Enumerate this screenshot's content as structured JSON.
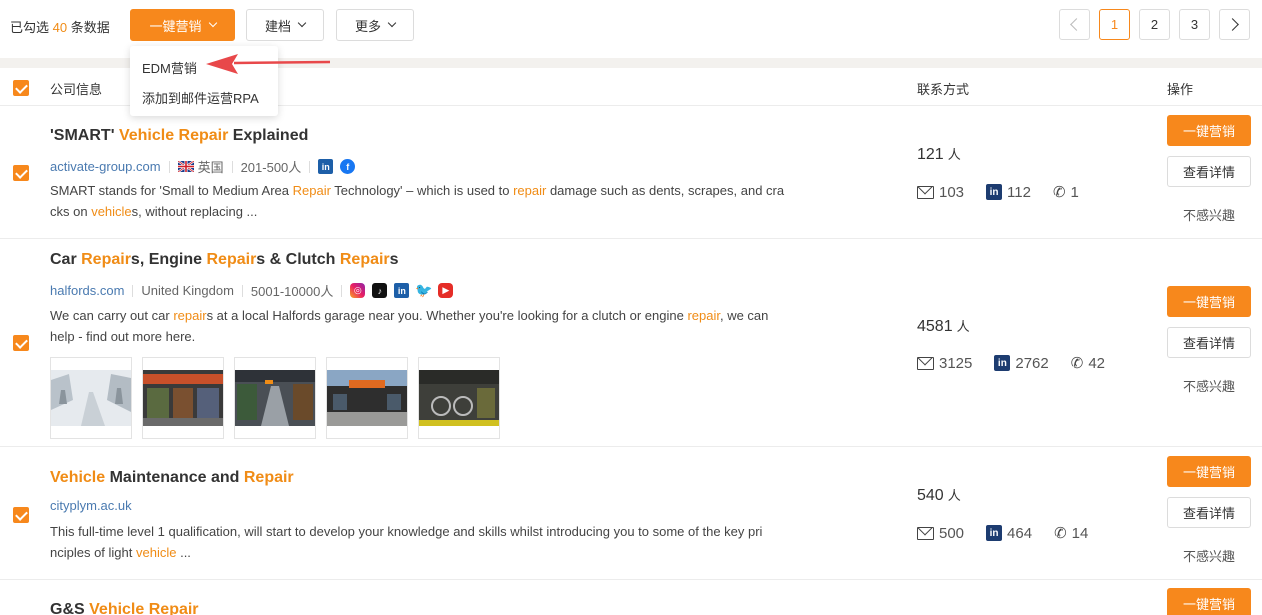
{
  "toolbar": {
    "selected_prefix": "已勾选",
    "selected_count": "40",
    "selected_suffix": "条数据",
    "btn_marketing": "一键营销",
    "btn_archive": "建档",
    "btn_more": "更多"
  },
  "pagination": {
    "pages": [
      "1",
      "2",
      "3"
    ],
    "current": "1"
  },
  "dropdown": {
    "items": [
      "EDM营销",
      "添加到邮件运营RPA"
    ]
  },
  "header": {
    "company": "公司信息",
    "contact": "联系方式",
    "action": "操作"
  },
  "rows": [
    {
      "title_parts": [
        "'SMART' ",
        "Vehicle",
        " ",
        "Repair",
        " Explained"
      ],
      "domain": "activate-group.com",
      "country": "英国",
      "size": "201-500人",
      "desc_parts": [
        "SMART stands for 'Small to Medium Area ",
        "Repair",
        " Technology' – which is used to ",
        "repair",
        " damage such as dents, scrapes, and cra",
        "cks on ",
        "vehicle",
        "s, without replacing ..."
      ],
      "contacts": "121",
      "unit": "人",
      "emails": "103",
      "linkedin": "112",
      "phones": "1"
    },
    {
      "title_parts": [
        "Car ",
        "Repair",
        "s, Engine ",
        "Repair",
        "s & Clutch ",
        "Repair",
        "s"
      ],
      "domain": "halfords.com",
      "country": "United Kingdom",
      "size": "5001-10000人",
      "desc_parts": [
        "We can carry out car ",
        "repair",
        "s at a local Halfords garage near you. Whether you're looking for a clutch or engine ",
        "repair",
        ", we can",
        "help - find out more here."
      ],
      "contacts": "4581",
      "unit": "人",
      "emails": "3125",
      "linkedin": "2762",
      "phones": "42"
    },
    {
      "title_parts": [
        "Vehicle",
        " Maintenance and ",
        "Repair"
      ],
      "domain": "cityplym.ac.uk",
      "desc_parts": [
        "This full-time level 1 qualification, will start to develop your knowledge and skills whilst introducing you to some of the key pri",
        "nciples of light ",
        "vehicle",
        " ..."
      ],
      "contacts": "540",
      "unit": "人",
      "emails": "500",
      "linkedin": "464",
      "phones": "14"
    },
    {
      "title_parts": [
        "G&S ",
        "Vehicle",
        " ",
        "Repair"
      ]
    }
  ],
  "actions": {
    "primary": "一键营销",
    "detail": "查看详情",
    "not_interested": "不感兴趣"
  },
  "icons": [
    "chevron-down-icon",
    "chevron-left-icon",
    "chevron-right-icon",
    "checkbox-checked-icon",
    "uk-flag-icon",
    "linkedin-icon",
    "facebook-icon",
    "instagram-icon",
    "tiktok-icon",
    "twitter-icon",
    "youtube-icon",
    "mail-icon",
    "phone-icon"
  ],
  "colors": {
    "accent": "#f7881c",
    "highlight": "#f08c16",
    "link": "#4a7ab0"
  }
}
